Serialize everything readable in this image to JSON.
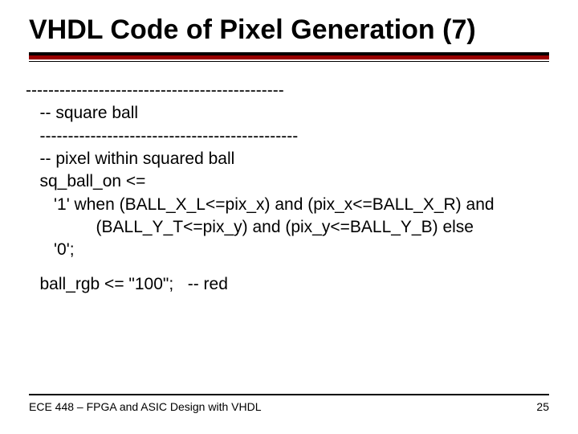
{
  "title": "VHDL Code of Pixel Generation (7)",
  "code": {
    "l1": "----------------------------------------------",
    "l2": "   -- square ball",
    "l3": "   ----------------------------------------------",
    "l4": "   -- pixel within squared ball",
    "l5": "   sq_ball_on <=",
    "l6": "      '1' when (BALL_X_L<=pix_x) and (pix_x<=BALL_X_R) and",
    "l7": "               (BALL_Y_T<=pix_y) and (pix_y<=BALL_Y_B) else",
    "l8": "      '0';",
    "l9": "   ball_rgb <= \"100\";   -- red"
  },
  "footer": {
    "left": "ECE 448 – FPGA and ASIC Design with VHDL",
    "right": "25"
  }
}
